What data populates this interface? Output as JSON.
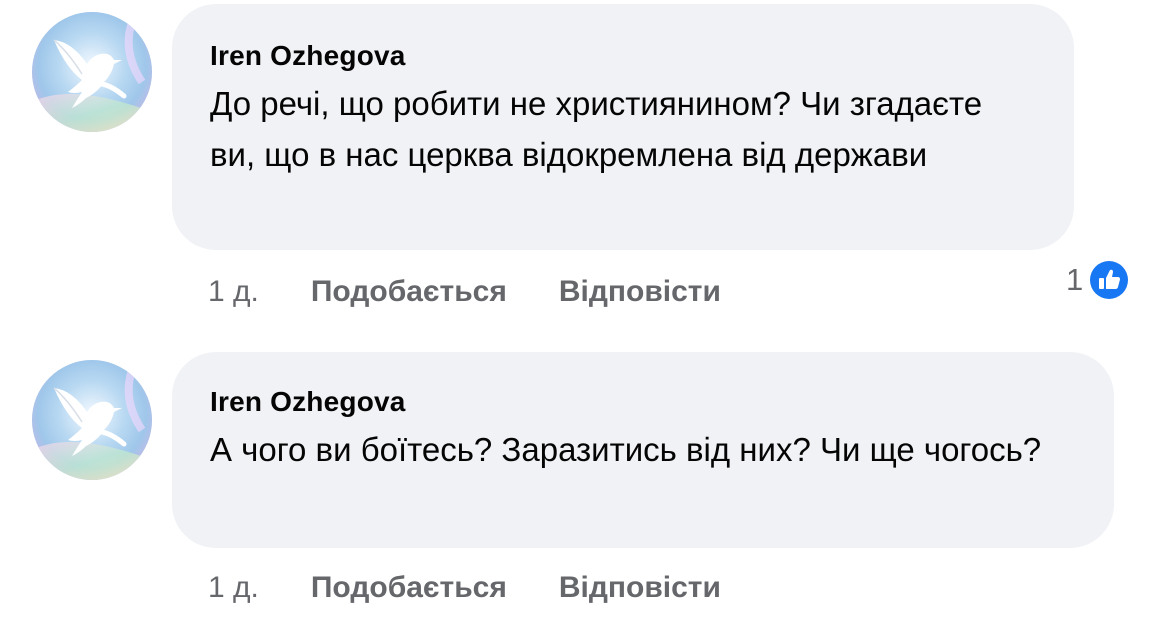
{
  "comments": [
    {
      "author": "Iren Ozhegova",
      "text": "До речі, що робити не християнином? Чи згадаєте ви, що в нас церква відокремлена від держави",
      "time": "1 д.",
      "like_label": "Подобається",
      "reply_label": "Відповісти",
      "reaction_count": "1",
      "reaction_icon": "like-icon"
    },
    {
      "author": "Iren Ozhegova",
      "text": "А чого ви боїтесь? Заразитись від них? Чи ще чогось?",
      "time": "1 д.",
      "like_label": "Подобається",
      "reply_label": "Відповісти"
    }
  ],
  "colors": {
    "bubble_bg": "#f0f2f5",
    "secondary_text": "#65676b",
    "like_blue": "#1877f2"
  }
}
